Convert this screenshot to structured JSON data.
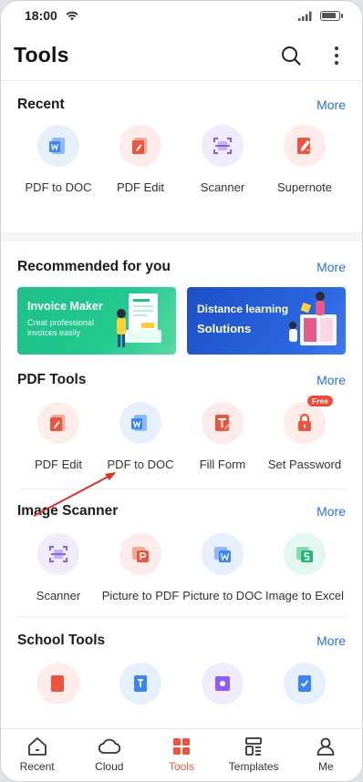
{
  "status": {
    "time": "18:00"
  },
  "header": {
    "title": "Tools"
  },
  "recent": {
    "title": "Recent",
    "more": "More",
    "items": [
      {
        "label": "PDF to DOC",
        "icon": "word-doc-icon"
      },
      {
        "label": "PDF Edit",
        "icon": "pdf-edit-icon"
      },
      {
        "label": "Scanner",
        "icon": "scanner-icon"
      },
      {
        "label": "Supernote",
        "icon": "supernote-icon"
      }
    ]
  },
  "recommended": {
    "title": "Recommended for you",
    "more": "More",
    "banners": [
      {
        "title": "Invoice Maker",
        "subtitle": "Creat professional invoices easily"
      },
      {
        "title": "Distance learning",
        "subtitle": "Solutions"
      }
    ]
  },
  "pdf_tools": {
    "title": "PDF Tools",
    "more": "More",
    "items": [
      {
        "label": "PDF Edit",
        "icon": "pdf-edit-icon"
      },
      {
        "label": "PDF to DOC",
        "icon": "word-doc-icon"
      },
      {
        "label": "Fill Form",
        "icon": "fill-form-icon"
      },
      {
        "label": "Set Password",
        "icon": "lock-icon",
        "badge": "Free"
      }
    ]
  },
  "image_scanner": {
    "title": "Image Scanner",
    "more": "More",
    "items": [
      {
        "label": "Scanner",
        "icon": "scanner-icon"
      },
      {
        "label": "Picture to PDF",
        "icon": "picture-pdf-icon"
      },
      {
        "label": "Picture to DOC",
        "icon": "picture-doc-icon"
      },
      {
        "label": "Image to Excel",
        "icon": "excel-icon"
      }
    ]
  },
  "school_tools": {
    "title": "School Tools",
    "more": "More"
  },
  "bottom_nav": {
    "items": [
      {
        "label": "Recent",
        "icon": "home-icon"
      },
      {
        "label": "Cloud",
        "icon": "cloud-icon"
      },
      {
        "label": "Tools",
        "icon": "tools-grid-icon",
        "active": true
      },
      {
        "label": "Templates",
        "icon": "templates-icon"
      },
      {
        "label": "Me",
        "icon": "person-icon"
      }
    ]
  },
  "colors": {
    "accent_blue": "#2a6fde",
    "active_red": "#e9553f",
    "word_blue": "#3b82f6",
    "pdf_red": "#e9553f",
    "scanner_purple": "#8b5cf6",
    "excel_green": "#22b573"
  }
}
